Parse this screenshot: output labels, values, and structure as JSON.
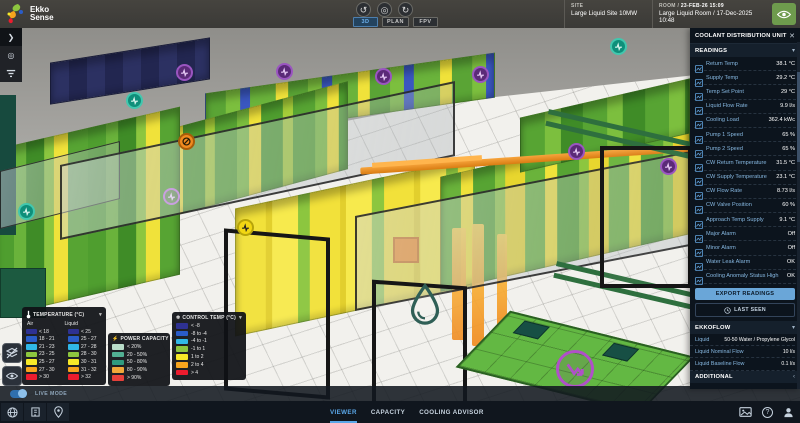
{
  "header": {
    "logo": {
      "line1": "Ekko",
      "line2": "Sense"
    },
    "view_controls": [
      {
        "name": "rotate-left",
        "glyph": "↺"
      },
      {
        "name": "reset-view",
        "glyph": "◎"
      },
      {
        "name": "rotate-right",
        "glyph": "↻"
      }
    ],
    "view_modes": [
      {
        "label": "3D",
        "active": true
      },
      {
        "label": "PLAN"
      },
      {
        "label": "FPV"
      }
    ],
    "site": {
      "label": "SITE",
      "value": "Large Liquid Site 10MW"
    },
    "room": {
      "label": "ROOM /",
      "timestamp": "23-FEB-26 15:09",
      "value": "Large Liquid Room / 17-Dec-2025 10:48"
    }
  },
  "cdu": {
    "title": "COOLANT DISTRIBUTION UNIT",
    "sections": {
      "readings": "READINGS",
      "ekkoflow": "EKKOFLOW",
      "additional": "ADDITIONAL"
    },
    "readings": [
      {
        "label": "Return Temp",
        "value": "38.1 °C"
      },
      {
        "label": "Supply Temp",
        "value": "29.2 °C"
      },
      {
        "label": "Temp Set Point",
        "value": "29 °C"
      },
      {
        "label": "Liquid Flow Rate",
        "value": "9.9 l/s"
      },
      {
        "label": "Cooling Load",
        "value": "362.4 kWc"
      },
      {
        "label": "Pump 1 Speed",
        "value": "65 %"
      },
      {
        "label": "Pump 2 Speed",
        "value": "65 %"
      },
      {
        "label": "CW Return Temperature",
        "value": "31.5 °C"
      },
      {
        "label": "CW Supply Temperature",
        "value": "23.1 °C"
      },
      {
        "label": "CW Flow Rate",
        "value": "8.73 l/s"
      },
      {
        "label": "CW Valve Position",
        "value": "60 %"
      },
      {
        "label": "Approach Temp Supply",
        "value": "9.1 °C"
      },
      {
        "label": "Major Alarm",
        "value": "Off"
      },
      {
        "label": "Minor Alarm",
        "value": "Off"
      },
      {
        "label": "Water Leak Alarm",
        "value": "OK"
      },
      {
        "label": "Cooling Anomaly Status High",
        "value": "OK"
      }
    ],
    "export_button": "EXPORT READINGS",
    "last_seen_button": "LAST SEEN",
    "ekkoflow": [
      {
        "label": "Liquid",
        "value": "50-50 Water / Propylene Glycol"
      },
      {
        "label": "Liquid Nominal Flow",
        "value": "10 l/s"
      },
      {
        "label": "Liquid Baseline Flow",
        "value": "0.1 l/s"
      }
    ]
  },
  "legends": {
    "temperature": {
      "title": "TEMPERATURE (°C)",
      "col_air": "Air",
      "col_liquid": "Liquid",
      "rows": [
        {
          "color": "#2e3192",
          "air": "< 18",
          "liquid": "< 25"
        },
        {
          "color": "#2a5cc8",
          "air": "18 - 21",
          "liquid": "25 - 27"
        },
        {
          "color": "#30b8e8",
          "air": "21 - 23",
          "liquid": "27 - 28"
        },
        {
          "color": "#8dc63f",
          "air": "23 - 25",
          "liquid": "28 - 30"
        },
        {
          "color": "#f7e928",
          "air": "25 - 27",
          "liquid": "30 - 31"
        },
        {
          "color": "#f7a41d",
          "air": "27 - 30",
          "liquid": "31 - 32"
        },
        {
          "color": "#ec1c2e",
          "air": "> 30",
          "liquid": "> 32"
        }
      ]
    },
    "power": {
      "title": "POWER CAPACITY",
      "rows": [
        {
          "color": "#b9ddc9",
          "label": "< 20%"
        },
        {
          "color": "#52b093",
          "label": "20 - 50%"
        },
        {
          "color": "#2f9b7f",
          "label": "50 - 80%"
        },
        {
          "color": "#f0a83a",
          "label": "80 - 90%"
        },
        {
          "color": "#e5403a",
          "label": "> 90%"
        }
      ]
    },
    "control": {
      "title": "CONTROL TEMP (°C)",
      "rows": [
        {
          "color": "#2e3192",
          "label": "< -8"
        },
        {
          "color": "#2a5cc8",
          "label": "-8 to -4"
        },
        {
          "color": "#30b8e8",
          "label": "-4 to -1"
        },
        {
          "color": "#8dc63f",
          "label": "-1 to 1"
        },
        {
          "color": "#f7e928",
          "label": "1 to 2"
        },
        {
          "color": "#f7a41d",
          "label": "2 to 4"
        },
        {
          "color": "#ec1c2e",
          "label": "> 4"
        }
      ]
    }
  },
  "footer": {
    "live_mode": "LIVE MODE",
    "tabs": [
      {
        "label": "VIEWER",
        "active": true
      },
      {
        "label": "CAPACITY"
      },
      {
        "label": "COOLING ADVISOR"
      }
    ]
  },
  "glyphs": {
    "chevron_down": "▾",
    "chevron_left": "‹",
    "close": "✕",
    "lightning": "⚡",
    "snowflake": "❄",
    "help": "?"
  },
  "colors": {
    "accent_blue": "#5aa7e8",
    "export_button": "#6aa6d8",
    "eye_button_green": "#6e9b4d",
    "sidebar_bg": "#0c141d"
  }
}
